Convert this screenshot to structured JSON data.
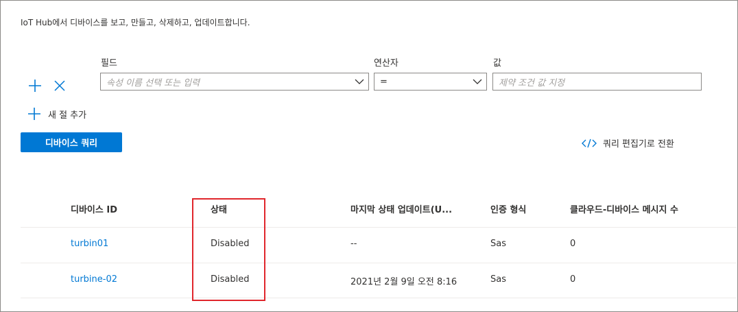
{
  "intro": "IoT Hub에서 디바이스를 보고, 만들고, 삭제하고, 업데이트합니다.",
  "filter": {
    "field_label": "필드",
    "operator_label": "연산자",
    "value_label": "값",
    "field_placeholder": "속성 이름 선택 또는 입력",
    "operator_value": "=",
    "value_placeholder": "제약 조건 값 지정",
    "add_icon": "plus-icon",
    "remove_icon": "close-icon"
  },
  "add_clause_label": "새 절 추가",
  "query_button_label": "디바이스 쿼리",
  "switch_editor_label": "쿼리 편집기로 전환",
  "table": {
    "headers": [
      "디바이스 ID",
      "상태",
      "마지막 상태 업데이트(U...",
      "인증 형식",
      "클라우드-디바이스 메시지 수"
    ],
    "rows": [
      {
        "id": "turbin01",
        "status": "Disabled",
        "last_update": "--",
        "auth": "Sas",
        "c2d": "0"
      },
      {
        "id": "turbine-02",
        "status": "Disabled",
        "last_update": "2021년 2월 9일 오전 8:16",
        "auth": "Sas",
        "c2d": "0"
      }
    ]
  },
  "colors": {
    "accent": "#0078d4",
    "highlight": "#e0252b"
  }
}
